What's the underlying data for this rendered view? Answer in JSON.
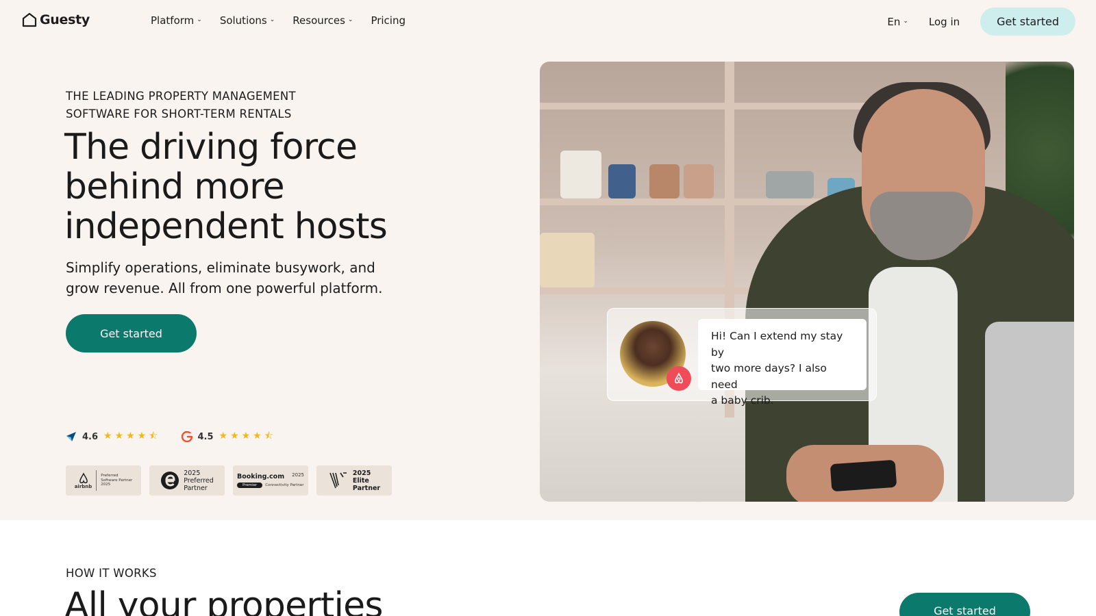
{
  "nav": {
    "brand": "Guesty",
    "links": [
      {
        "label": "Platform",
        "has_dropdown": true
      },
      {
        "label": "Solutions",
        "has_dropdown": true
      },
      {
        "label": "Resources",
        "has_dropdown": true
      },
      {
        "label": "Pricing",
        "has_dropdown": false
      }
    ],
    "language": "En",
    "login_label": "Log in",
    "cta_label": "Get started"
  },
  "hero": {
    "eyebrow_line1": "THE LEADING PROPERTY MANAGEMENT",
    "eyebrow_line2": "SOFTWARE FOR SHORT-TERM RENTALS",
    "headline_line1": "The driving force",
    "headline_line2": "behind more",
    "headline_line3": "independent hosts",
    "subhead_line1": "Simplify operations, eliminate busywork, and",
    "subhead_line2": "grow revenue. All from one powerful platform.",
    "cta_label": "Get started",
    "ratings": [
      {
        "source_icon": "capterra-icon",
        "score": "4.6",
        "stars": 4.5
      },
      {
        "source_icon": "g2-icon",
        "score": "4.5",
        "stars": 4.5
      }
    ],
    "badges": {
      "airbnb": {
        "brand": "airbnb",
        "line1": "Preferred",
        "line2": "Software Partner",
        "year": "2025"
      },
      "expedia": {
        "year": "2025",
        "line1": "Preferred",
        "line2": "Partner"
      },
      "booking": {
        "brand": "Booking.com",
        "year": "2025",
        "tag": "Premier",
        "sub": "Connectivity Partner"
      },
      "vrbo": {
        "year": "2025",
        "line1": "Elite",
        "line2": "Partner"
      }
    },
    "chat": {
      "line1": "Hi! Can I extend my stay by",
      "line2": "two more days? I also need",
      "line3": "a baby crib.",
      "channel_icon": "airbnb-icon"
    }
  },
  "how": {
    "eyebrow": "HOW IT WORKS",
    "title": "All your properties",
    "cta_label": "Get started"
  },
  "colors": {
    "background": "#f9f4f0",
    "primary": "#0b7a6c",
    "nav_cta": "#cdeeed",
    "star": "#f2b81a",
    "airbnb": "#ef4b58"
  }
}
